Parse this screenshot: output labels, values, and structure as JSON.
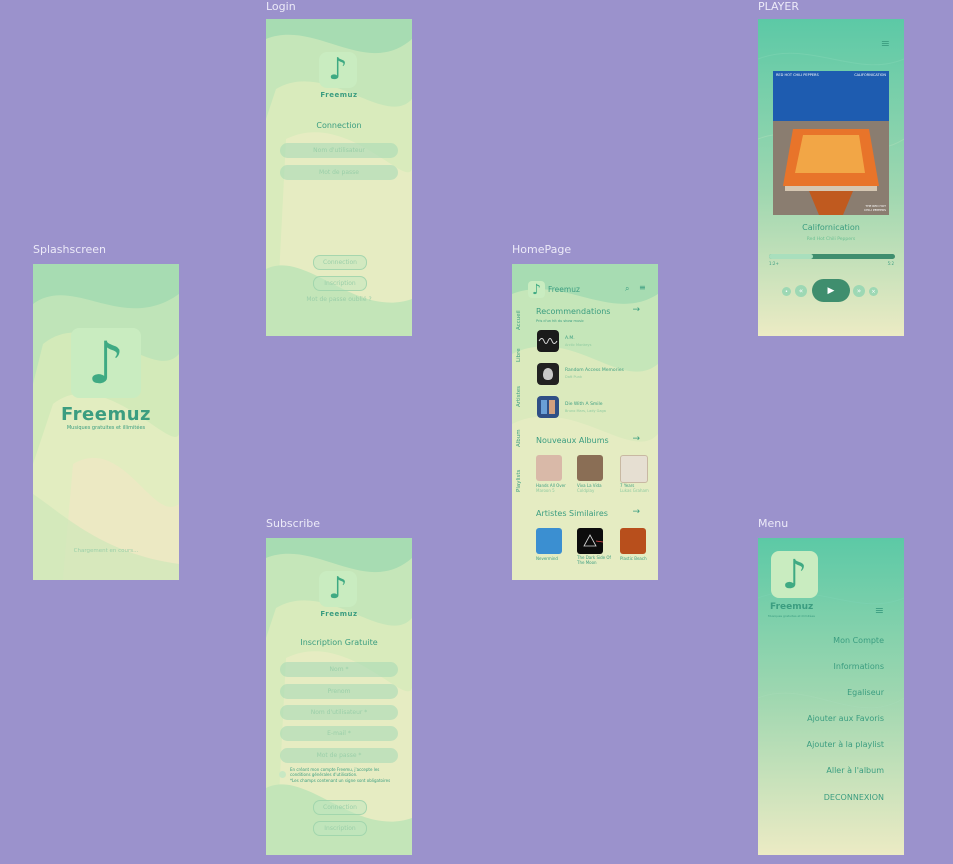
{
  "labels": {
    "splash": "Splashscreen",
    "login": "Login",
    "subscribe": "Subscribe",
    "home": "HomePage",
    "player": "PLAYER",
    "menu": "Menu"
  },
  "brand": {
    "name": "Freemuz",
    "tagline": "Musiques gratuites et illimitées",
    "note_glyph": "♪"
  },
  "splash": {
    "loading": "Chargement en cours..."
  },
  "login": {
    "title": "Connection",
    "username_placeholder": "Nom d'utilisateur",
    "password_placeholder": "Mot de passe",
    "connect_button": "Connection",
    "register_button": "Inscription",
    "forgot_link": "Mot de passe oublié ?"
  },
  "subscribe": {
    "title": "Inscription Gratuite",
    "fields": [
      "Nom *",
      "Prenom",
      "Nom d'utilisateur *",
      "E-mail *",
      "Mot de passe *"
    ],
    "terms": "En créant mon compte Freemu, j'accepte les conditions générales d'utilisation.",
    "required_note": "*Les champs contenant un signe sont obligatoires",
    "connect_button": "Connection",
    "register_button": "Inscription"
  },
  "home": {
    "header_name": "Freemuz",
    "side_tabs": [
      "Accueil",
      "Libre",
      "Artistes",
      "Album",
      "Playlists"
    ],
    "recommendations": {
      "title": "Recommendations",
      "subtitle": "Pris d'un hit du show music",
      "items": [
        {
          "title": "A.M.",
          "subtitle": "Arctic Monkeys"
        },
        {
          "title": "Random Access Memories",
          "subtitle": "Daft Punk"
        },
        {
          "title": "Die With A Smile",
          "subtitle": "Bruno Mars, Lady Gaga"
        }
      ]
    },
    "new_albums": {
      "title": "Nouveaux Albums",
      "items": [
        {
          "title": "Hands All Over",
          "subtitle": "Maroon 5"
        },
        {
          "title": "Viva La Vida",
          "subtitle": "Coldplay"
        },
        {
          "title": "7 Years",
          "subtitle": "Lukas Graham"
        }
      ]
    },
    "similar_artists": {
      "title": "Artistes Similaires",
      "items": [
        {
          "title": "Nevermind"
        },
        {
          "title": "The Dark Side Of The Moon"
        },
        {
          "title": "Plastic Beach"
        }
      ]
    }
  },
  "player": {
    "cover_top_left": "RED HOT CHILI PEPPERS",
    "cover_top_right": "CALIFORNICATION",
    "cover_bottom_right": "THE RED HOT CHILI PEPPERS",
    "track": "Californication",
    "artist": "Red Hot Chili Peppers",
    "time_current": "1:2+",
    "time_total": "5:2",
    "progress": 0.35,
    "play_glyph": "▶",
    "prev_glyph": "«",
    "next_glyph": "»"
  },
  "menu": {
    "items": [
      "Mon Compte",
      "Informations",
      "Egaliseur",
      "Ajouter aux Favoris",
      "Ajouter à la playlist",
      "Aller à l'album",
      "DECONNEXION"
    ]
  },
  "colors": {
    "background": "#9b92cc",
    "accent": "#3b9d80",
    "mint": "#a8dbb5",
    "cream": "#ecebc4",
    "teal": "#5cc9a6"
  }
}
